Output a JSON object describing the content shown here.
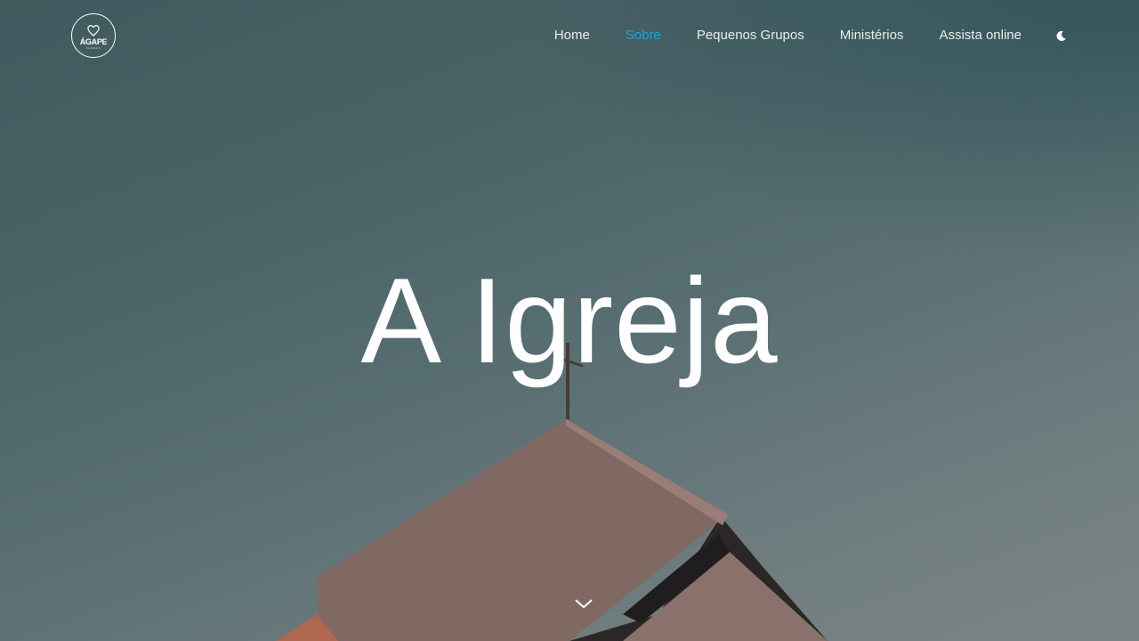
{
  "brand": {
    "logo_text": "ÁGAPE",
    "logo_subtext": "IGREJA"
  },
  "nav": {
    "items": [
      {
        "label": "Home",
        "active": false
      },
      {
        "label": "Sobre",
        "active": true
      },
      {
        "label": "Pequenos Grupos",
        "active": false
      },
      {
        "label": "Ministérios",
        "active": false
      },
      {
        "label": "Assista online",
        "active": false
      }
    ],
    "theme_toggle_icon": "moon-icon"
  },
  "hero": {
    "title": "A Igreja",
    "scroll_icon": "chevron-down-icon"
  },
  "colors": {
    "accent": "#1aa7d9",
    "nav_text": "#e8eced",
    "title": "#ffffff"
  }
}
